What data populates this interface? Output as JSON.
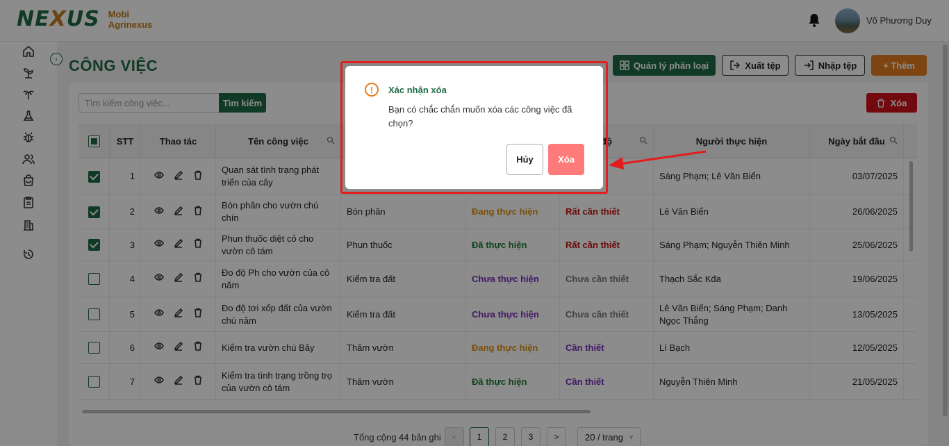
{
  "app": {
    "logo_text": "NEXUS",
    "brand_line1": "Mobi",
    "brand_line2": "Agrinexus"
  },
  "header": {
    "user_name": "Võ Phương Duy"
  },
  "sidebar": {
    "icons": [
      "home-icon",
      "sprout-icon",
      "palm-tree-icon",
      "flask-icon",
      "bug-icon",
      "users-icon",
      "shopping-bag-icon",
      "clipboard-icon",
      "building-icon",
      "history-icon"
    ]
  },
  "page": {
    "title": "CÔNG VIỆC"
  },
  "toolbar": {
    "manage_label": "Quản lý phân loại",
    "export_label": "Xuất tệp",
    "import_label": "Nhập tệp",
    "add_label": "+ Thêm"
  },
  "search": {
    "placeholder": "Tìm kiếm công việc...",
    "button_label": "Tìm kiếm"
  },
  "delete_button": {
    "label": "Xóa"
  },
  "table": {
    "headers": {
      "stt": "STT",
      "actions": "Thao tác",
      "name": "Tên công việc",
      "status": "độ",
      "assignee": "Người thực hiện",
      "start_date": "Ngày bắt đầu"
    },
    "rows": [
      {
        "checked": true,
        "stt": "1",
        "name": "Quan sát tình trạng phát triển của cây",
        "category": "",
        "status": "",
        "status_class": "",
        "priority": "",
        "priority_class": "",
        "assignee": "Sáng Phạm; Lê  Văn Biển",
        "date": "03/07/2025"
      },
      {
        "checked": true,
        "stt": "2",
        "name": "Bón phân cho vườn chú chín",
        "category": "Bón phân",
        "status": "Đang thực hiện",
        "status_class": "st-dang",
        "priority": "Rất cần thiết",
        "priority_class": "mt-rat",
        "assignee": "Lê  Văn Biển",
        "date": "26/06/2025"
      },
      {
        "checked": true,
        "stt": "3",
        "name": "Phun thuốc diệt cỏ cho vườn cô tám",
        "category": "Phun thuốc",
        "status": "Đã thực hiện",
        "status_class": "st-da",
        "priority": "Rất cần thiết",
        "priority_class": "mt-rat",
        "assignee": "Sáng Phạm; Nguyễn  Thiên Minh",
        "date": "25/06/2025"
      },
      {
        "checked": false,
        "stt": "4",
        "name": "Đo độ Ph cho vườn của cô năm",
        "category": "Kiểm tra đất",
        "status": "Chưa thực hiện",
        "status_class": "st-chua",
        "priority": "Chưa cần thiết",
        "priority_class": "mt-chua",
        "assignee": "Thạch Sắc Kđa",
        "date": "19/06/2025"
      },
      {
        "checked": false,
        "stt": "5",
        "name": "Đo độ tơi xốp đất của vườn chú năm",
        "category": "Kiểm tra đất",
        "status": "Chưa thực hiện",
        "status_class": "st-chua",
        "priority": "Chưa cần thiết",
        "priority_class": "mt-chua",
        "assignee": "Lê  Văn Biển; Sáng Phạm; Danh  Ngọc Thắng",
        "date": "13/05/2025"
      },
      {
        "checked": false,
        "stt": "6",
        "name": "Kiểm tra vườn chú Bảy",
        "category": "Thăm vườn",
        "status": "Đang thực hiện",
        "status_class": "st-dang",
        "priority": "Cần thiết",
        "priority_class": "mt-can",
        "assignee": "Lí  Bạch",
        "date": "12/05/2025"
      },
      {
        "checked": false,
        "stt": "7",
        "name": "Kiểm tra tình trạng trồng trọ của vườn cô tám",
        "category": "Thăm vườn",
        "status": "Đã thực hiện",
        "status_class": "st-da",
        "priority": "Cần thiết",
        "priority_class": "mt-can",
        "assignee": "Nguyễn  Thiên Minh",
        "date": "21/05/2025"
      }
    ]
  },
  "pagination": {
    "total_text": "Tổng cộng 44 bản ghi",
    "pages": [
      "1",
      "2",
      "3"
    ],
    "current": "1",
    "page_size": "20 / trang",
    "prev": "<",
    "next": ">"
  },
  "modal": {
    "title": "Xác nhận xóa",
    "message": "Bạn có chắc chắn muốn xóa các công việc đã chọn?",
    "cancel_label": "Hủy",
    "confirm_label": "Xóa",
    "frame_color": "#e21d1d"
  },
  "colors": {
    "brand_green": "#1e6b46",
    "accent_orange": "#e67e22",
    "danger_red": "#d0121b"
  }
}
